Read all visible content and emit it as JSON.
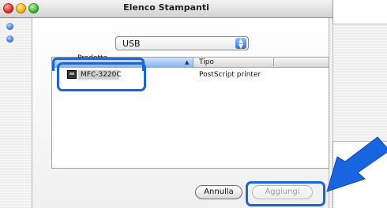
{
  "window": {
    "title": "Elenco Stampanti"
  },
  "connection": {
    "selected": "USB",
    "arrows_glyph": "▲▼"
  },
  "list": {
    "columns": [
      "Prodotto",
      "Tipo"
    ],
    "rows": [
      {
        "name": "MFC-3220C",
        "type": "PostScript printer",
        "icon": "printer-icon"
      }
    ]
  },
  "buttons": {
    "cancel": "Annulla",
    "add": "Aggiungi"
  },
  "colors": {
    "highlight": "#1865e2",
    "selection_header": "#86b4f0"
  }
}
